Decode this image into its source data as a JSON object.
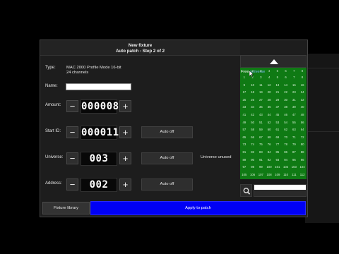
{
  "window": {
    "title": "New fixture",
    "subtitle": "Auto patch - Step 2 of 2"
  },
  "fixture": {
    "type_label": "Type:",
    "type_value": "MAC 2000 Profile Mode 16-bit",
    "channels": "24 channels",
    "name_label": "Name:",
    "name_value": ""
  },
  "fields": {
    "amount": {
      "label": "Amount:",
      "value": "000008"
    },
    "start_id": {
      "label": "Start ID:",
      "value": "000011",
      "auto_label": "Auto off"
    },
    "universe": {
      "label": "Universe:",
      "value": "003",
      "auto_label": "Auto off",
      "status": "Universe unused"
    },
    "address": {
      "label": "Address:",
      "value": "002",
      "auto_label": "Auto off"
    }
  },
  "grid": {
    "label_free": "Free",
    "label_universe": "universe",
    "headers": [
      "1",
      "2",
      "3",
      "4",
      "5",
      "6",
      "7",
      "8"
    ],
    "rows": [
      [
        "1",
        "2",
        "3",
        "4",
        "5",
        "6",
        "7",
        "8"
      ],
      [
        "9",
        "10",
        "11",
        "12",
        "13",
        "14",
        "15",
        "16"
      ],
      [
        "17",
        "18",
        "19",
        "20",
        "21",
        "22",
        "23",
        "24"
      ],
      [
        "25",
        "26",
        "27",
        "28",
        "29",
        "30",
        "31",
        "32"
      ],
      [
        "33",
        "34",
        "35",
        "36",
        "37",
        "38",
        "39",
        "40"
      ],
      [
        "41",
        "42",
        "43",
        "44",
        "45",
        "46",
        "47",
        "48"
      ],
      [
        "49",
        "50",
        "51",
        "52",
        "53",
        "54",
        "55",
        "56"
      ],
      [
        "57",
        "58",
        "59",
        "60",
        "61",
        "62",
        "63",
        "64"
      ],
      [
        "65",
        "66",
        "67",
        "68",
        "69",
        "70",
        "71",
        "72"
      ],
      [
        "73",
        "74",
        "75",
        "76",
        "77",
        "78",
        "79",
        "80"
      ],
      [
        "81",
        "82",
        "83",
        "84",
        "85",
        "86",
        "87",
        "88"
      ],
      [
        "89",
        "90",
        "91",
        "92",
        "93",
        "94",
        "95",
        "96"
      ],
      [
        "97",
        "98",
        "99",
        "100",
        "101",
        "102",
        "103",
        "104"
      ],
      [
        "105",
        "106",
        "107",
        "108",
        "109",
        "110",
        "111",
        "112"
      ]
    ]
  },
  "footer": {
    "library_label": "Fixture library",
    "apply_label": "Apply to patch"
  },
  "colors": {
    "grid_green": "#0f7a14",
    "apply_blue": "#0000f5"
  },
  "icons": [
    "arrow-up-icon",
    "arrow-down-icon",
    "magnifier-icon",
    "minus-icon",
    "plus-icon"
  ]
}
